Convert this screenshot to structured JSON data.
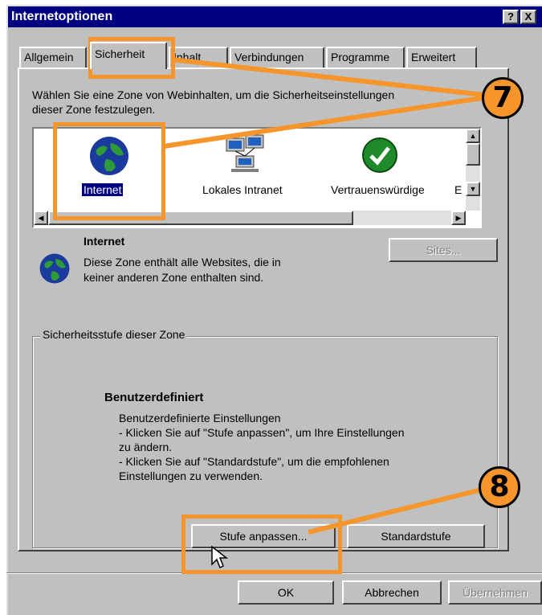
{
  "window": {
    "title": "Internetoptionen",
    "help_btn": "?",
    "close_btn": "X"
  },
  "tabs": [
    {
      "label": "Allgemein",
      "active": false
    },
    {
      "label": "Sicherheit",
      "active": true
    },
    {
      "label": "Inhalt",
      "active": false
    },
    {
      "label": "Verbindungen",
      "active": false
    },
    {
      "label": "Programme",
      "active": false
    },
    {
      "label": "Erweitert",
      "active": false
    }
  ],
  "security": {
    "intro_line1": "Wählen Sie eine Zone von Webinhalten, um die Sicherheitseinstellungen",
    "intro_line2": "dieser Zone festzulegen.",
    "zones": [
      {
        "label": "Internet",
        "icon": "globe-icon",
        "selected": true
      },
      {
        "label": "Lokales Intranet",
        "icon": "network-computers-icon",
        "selected": false
      },
      {
        "label": "Vertrauenswürdige",
        "icon": "checkmark-icon",
        "selected": false
      },
      {
        "label": "E",
        "icon": "restricted-icon",
        "selected": false
      }
    ],
    "zone_name": "Internet",
    "zone_desc_line1": "Diese Zone enthält alle Websites, die in",
    "zone_desc_line2": "keiner anderen Zone enthalten sind.",
    "sites_button": "Sites...",
    "level_group_label": "Sicherheitsstufe dieser Zone",
    "level_title": "Benutzerdefiniert",
    "level_desc": [
      "Benutzerdefinierte Einstellungen",
      "- Klicken Sie auf \"Stufe anpassen\", um Ihre Einstellungen",
      "zu ändern.",
      "- Klicken Sie auf \"Standardstufe\", um die empfohlenen",
      "Einstellungen zu verwenden."
    ],
    "custom_level_button": "Stufe anpassen...",
    "default_level_button": "Standardstufe"
  },
  "footer": {
    "ok": "OK",
    "cancel": "Abbrechen",
    "apply": "Übernehmen"
  },
  "annotations": {
    "step7": "7",
    "step8": "8",
    "accent_color": "#f5952c"
  }
}
